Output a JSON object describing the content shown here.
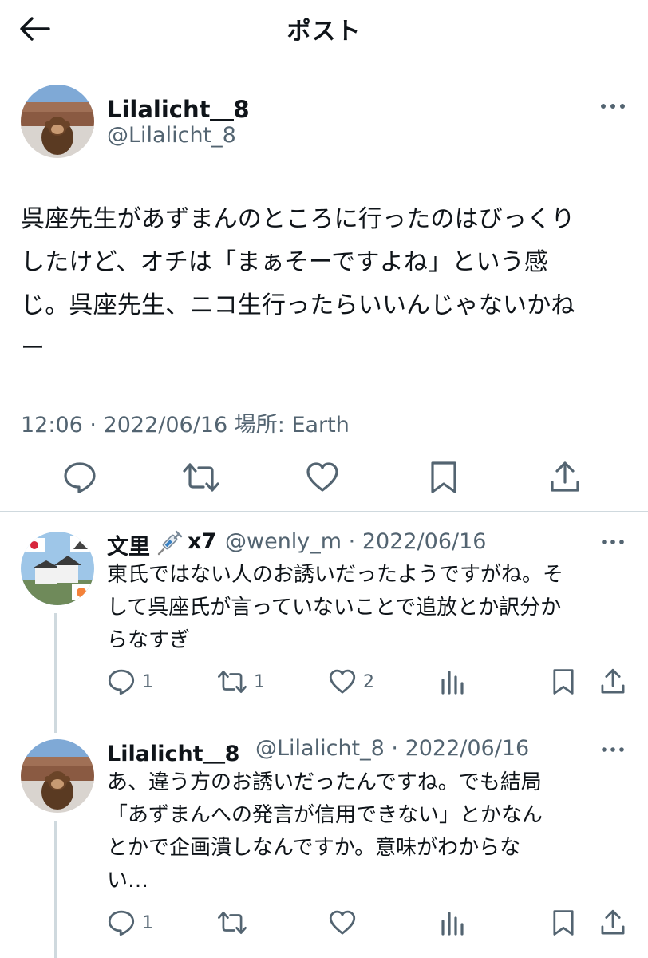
{
  "header": {
    "title": "ポスト"
  },
  "main_post": {
    "display_name": "Lilalicht＿8",
    "handle": "@Lilalicht_8",
    "text": "呉座先生があずまんのところに行ったのはびっくり\nしたけど、オチは「まぁそーですよね」という感\nじ。呉座先生、ニコ生行ったらいいんじゃないかね\nー",
    "meta": "12:06 · 2022/06/16 場所: Earth",
    "actions": [
      "reply-icon",
      "repost-icon",
      "like-icon",
      "bookmark-icon",
      "share-icon"
    ]
  },
  "replies": [
    {
      "display_name": "文里",
      "name_suffix": "x7",
      "meta": "@wenly_m · 2022/06/16",
      "text": "東氏ではない人のお誘いだったようですがね。そ\nして呉座氏が言っていないことで追放とか訳分か\nらなすぎ",
      "reply_count": "1",
      "repost_count": "1",
      "like_count": "2"
    },
    {
      "display_name": "Lilalicht＿8",
      "meta": "@Lilalicht_8 · 2022/06/16",
      "text": "あ、違う方のお誘いだったんですね。でも結局\n「あずまんへの発言が信用できない」とかなん\nとかで企画潰しなんですか。意味がわからな\nい…",
      "reply_count": "1"
    }
  ],
  "colors": {
    "text": "#0f1419",
    "secondary": "#536471",
    "divider": "#cfd9de"
  }
}
